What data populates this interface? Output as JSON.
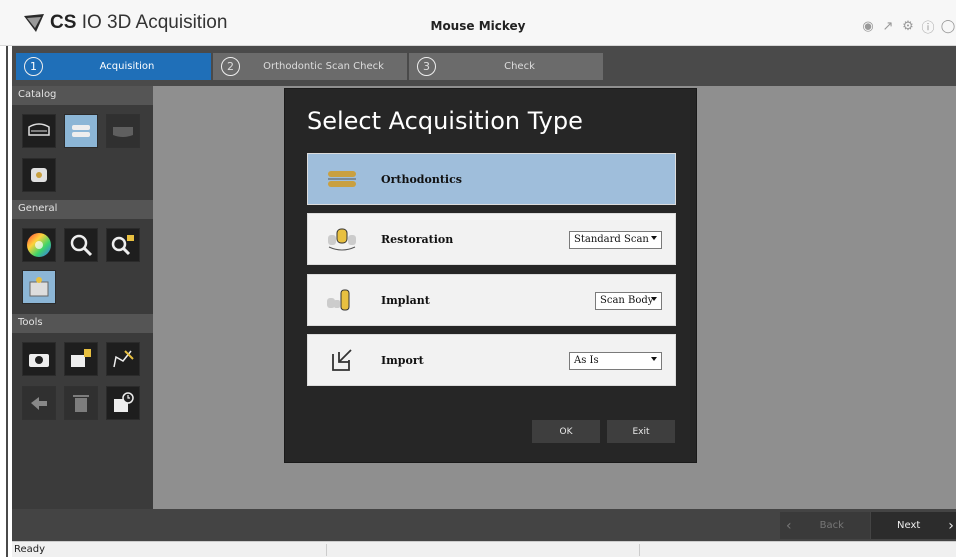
{
  "app": {
    "brand": "CS",
    "name": "IO 3D Acquisition",
    "patient": "Mouse Mickey"
  },
  "title_icons": [
    "marker-icon",
    "export-icon",
    "settings-icon",
    "info-icon",
    "close-icon"
  ],
  "steps": [
    {
      "num": "1",
      "label": "Acquisition",
      "active": true
    },
    {
      "num": "2",
      "label": "Orthodontic Scan Check",
      "active": false
    },
    {
      "num": "3",
      "label": "Check",
      "active": false
    }
  ],
  "sidebar": {
    "catalog": "Catalog",
    "general": "General",
    "tools": "Tools"
  },
  "dialog": {
    "title": "Select Acquisition Type",
    "options": [
      {
        "name": "Orthodontics",
        "selected": true,
        "dropdown": ""
      },
      {
        "name": "Restoration",
        "selected": false,
        "dropdown": "Standard Scan"
      },
      {
        "name": "Implant",
        "selected": false,
        "dropdown": "Scan Body"
      },
      {
        "name": "Import",
        "selected": false,
        "dropdown": "As Is"
      }
    ],
    "ok": "OK",
    "exit": "Exit"
  },
  "nav": {
    "back": "Back",
    "next": "Next"
  },
  "status": "Ready",
  "colors": {
    "accent": "#1f6fb8",
    "selected_option": "#9fbedb",
    "dialog_bg": "#262626"
  }
}
